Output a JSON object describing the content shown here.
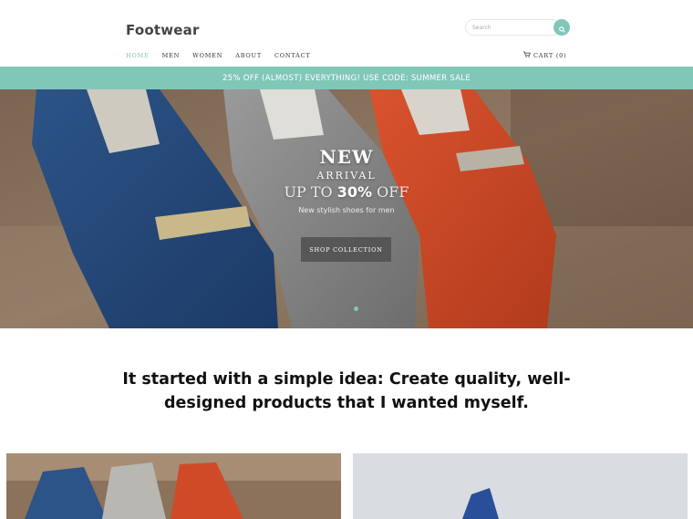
{
  "header": {
    "logo": "Footwear",
    "search_placeholder": "Search",
    "search_icon": "search-icon",
    "nav": [
      {
        "label": "HOME",
        "active": true
      },
      {
        "label": "MEN",
        "active": false
      },
      {
        "label": "WOMEN",
        "active": false
      },
      {
        "label": "ABOUT",
        "active": false
      },
      {
        "label": "CONTACT",
        "active": false
      }
    ],
    "cart_label": "CART (0)",
    "cart_icon": "cart-icon"
  },
  "promo": {
    "text": "25% OFF (ALMOST) EVERYTHING! USE CODE: SUMMER SALE"
  },
  "hero": {
    "title": "NEW",
    "subtitle": "ARRIVAL",
    "offer_prefix": "UP TO",
    "offer_value": "30%",
    "offer_suffix": "OFF",
    "description": "New stylish shoes for men",
    "button_label": "SHOP COLLECTION"
  },
  "tagline": "It started with a simple idea: Create quality, well-designed products that I wanted myself.",
  "colors": {
    "accent": "#81c7b8",
    "text_dark": "#111111",
    "button_bg": "#505050"
  }
}
